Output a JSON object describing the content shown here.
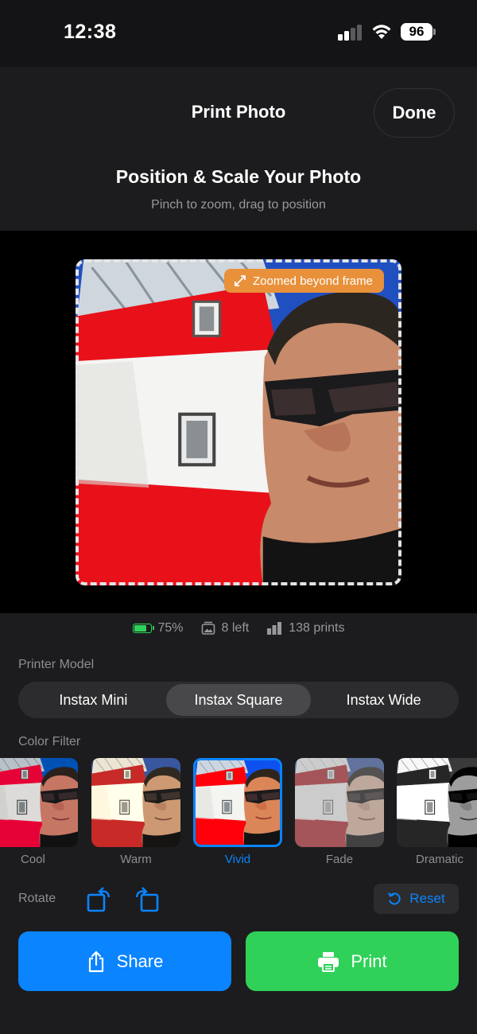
{
  "status_bar": {
    "time": "12:38",
    "battery": "96"
  },
  "header": {
    "title": "Print Photo",
    "done_label": "Done"
  },
  "editor": {
    "headline": "Position & Scale Your Photo",
    "instructions": "Pinch to zoom, drag to position",
    "zoom_badge": "Zoomed beyond frame"
  },
  "printer_status": {
    "battery": "75%",
    "films_left": "8 left",
    "prints": "138 prints"
  },
  "printer_model": {
    "label": "Printer Model",
    "options": [
      "Instax Mini",
      "Instax Square",
      "Instax Wide"
    ],
    "selected": "Instax Square"
  },
  "color_filter": {
    "label": "Color Filter",
    "options": [
      "Cool",
      "Warm",
      "Vivid",
      "Fade",
      "Dramatic"
    ],
    "selected": "Vivid"
  },
  "rotate": {
    "label": "Rotate",
    "reset_label": "Reset"
  },
  "actions": {
    "share_label": "Share",
    "print_label": "Print"
  },
  "colors": {
    "accent_blue": "#0a84ff",
    "print_green": "#30d158",
    "badge_orange": "#e8913a"
  }
}
